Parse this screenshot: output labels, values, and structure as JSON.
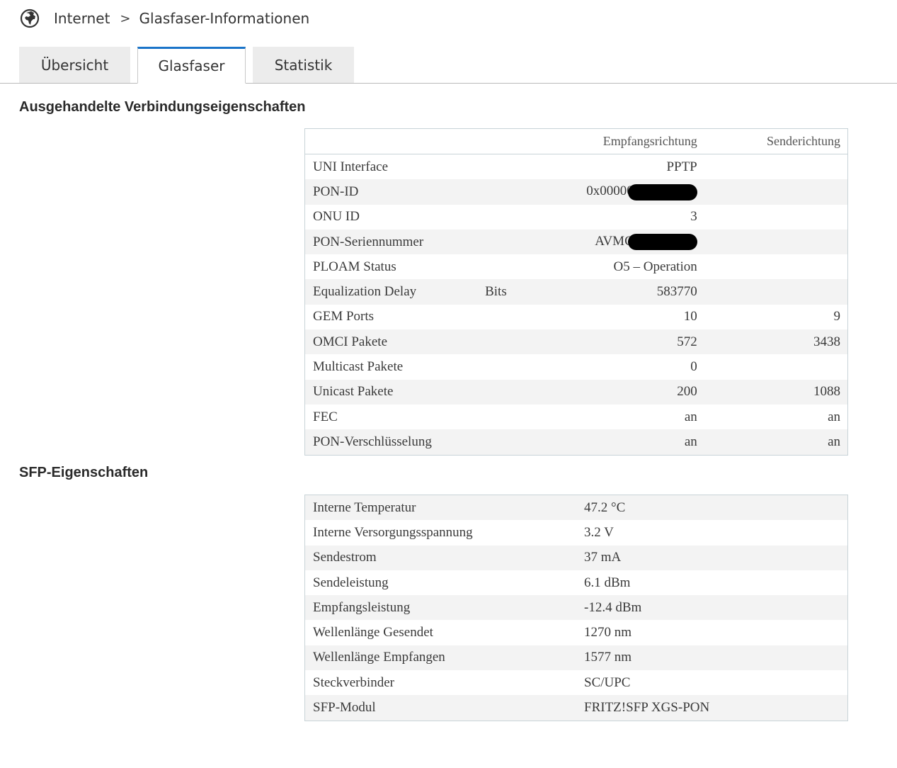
{
  "breadcrumb": {
    "icon": "globe-icon",
    "items": [
      "Internet",
      "Glasfaser-Informationen"
    ],
    "separator": ">"
  },
  "tabs": [
    {
      "label": "Übersicht",
      "active": false
    },
    {
      "label": "Glasfaser",
      "active": true
    },
    {
      "label": "Statistik",
      "active": false
    }
  ],
  "colors": {
    "accent": "#1a74c9",
    "row_alt": "#f3f3f3",
    "tab_inactive": "#ececec"
  },
  "connection": {
    "title": "Ausgehandelte Verbindungseigenschaften",
    "headers": {
      "rx": "Empfangsrichtung",
      "tx": "Senderichtung"
    },
    "rows": [
      {
        "label": "UNI Interface",
        "unit": "",
        "rx": "PPTP",
        "tx": ""
      },
      {
        "label": "PON-ID",
        "unit": "",
        "rx": "0x00000",
        "tx": "",
        "redacted": true
      },
      {
        "label": "ONU ID",
        "unit": "",
        "rx": "3",
        "tx": ""
      },
      {
        "label": "PON-Seriennummer",
        "unit": "",
        "rx": "AVMC",
        "tx": "",
        "redacted": true
      },
      {
        "label": "PLOAM Status",
        "unit": "",
        "rx": "O5 – Operation",
        "tx": ""
      },
      {
        "label": "Equalization Delay",
        "unit": "Bits",
        "rx": "583770",
        "tx": ""
      },
      {
        "label": "GEM Ports",
        "unit": "",
        "rx": "10",
        "tx": "9"
      },
      {
        "label": "OMCI Pakete",
        "unit": "",
        "rx": "572",
        "tx": "3438"
      },
      {
        "label": "Multicast Pakete",
        "unit": "",
        "rx": "0",
        "tx": ""
      },
      {
        "label": "Unicast Pakete",
        "unit": "",
        "rx": "200",
        "tx": "1088"
      },
      {
        "label": "FEC",
        "unit": "",
        "rx": "an",
        "tx": "an"
      },
      {
        "label": "PON-Verschlüsselung",
        "unit": "",
        "rx": "an",
        "tx": "an"
      }
    ]
  },
  "sfp": {
    "title": "SFP-Eigenschaften",
    "rows": [
      {
        "label": "Interne Temperatur",
        "value": "47.2 °C"
      },
      {
        "label": "Interne Versorgungsspannung",
        "value": "3.2 V"
      },
      {
        "label": "Sendestrom",
        "value": "37 mA"
      },
      {
        "label": "Sendeleistung",
        "value": "6.1 dBm"
      },
      {
        "label": "Empfangsleistung",
        "value": "-12.4 dBm"
      },
      {
        "label": "Wellenlänge Gesendet",
        "value": "1270 nm"
      },
      {
        "label": "Wellenlänge Empfangen",
        "value": "1577 nm"
      },
      {
        "label": "Steckverbinder",
        "value": "SC/UPC"
      },
      {
        "label": "SFP-Modul",
        "value": "FRITZ!SFP XGS-PON"
      }
    ]
  }
}
